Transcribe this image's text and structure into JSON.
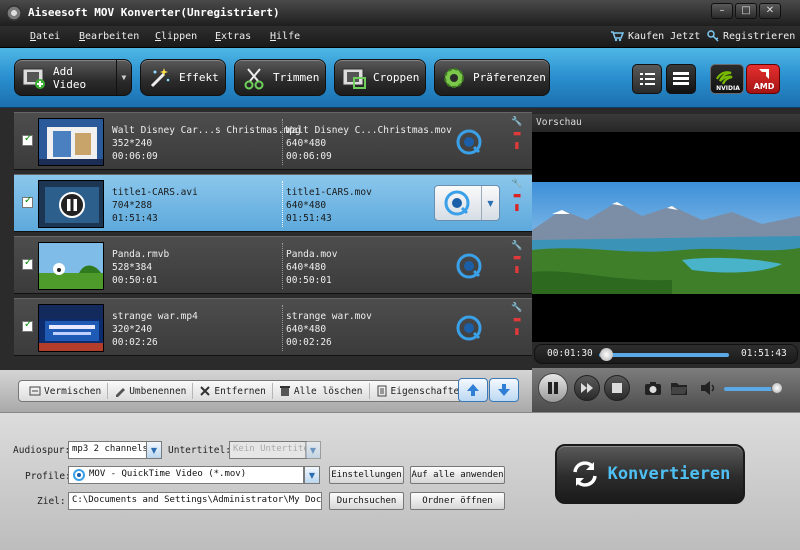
{
  "window": {
    "title": "Aiseesoft MOV Konverter(Unregistriert)",
    "min": "–",
    "max": "□",
    "close": "✕"
  },
  "menu": {
    "items": [
      {
        "label": "Datei",
        "u": "D",
        "rest": "atei"
      },
      {
        "label": "Bearbeiten",
        "u": "B",
        "rest": "earbeiten"
      },
      {
        "label": "Clippen",
        "u": "C",
        "rest": "lippen"
      },
      {
        "label": "Extras",
        "u": "E",
        "rest": "xtras"
      },
      {
        "label": "Hilfe",
        "u": "H",
        "rest": "ilfe"
      }
    ],
    "buy": "Kaufen Jetzt",
    "register": "Registrieren"
  },
  "toolbar": {
    "add_video": "Add Video",
    "effekt": "Effekt",
    "trimmen": "Trimmen",
    "croppen": "Croppen",
    "praeferenzen": "Präferenzen",
    "nvidia": "NVIDIA",
    "amd": "AMD"
  },
  "files": [
    {
      "src_name": "Walt Disney Car...s Christmas.mpg",
      "src_res": "352*240",
      "src_dur": "00:06:09",
      "out_name": "Walt Disney C...Christmas.mov",
      "out_res": "640*480",
      "out_dur": "00:06:09",
      "selected": false
    },
    {
      "src_name": "title1-CARS.avi",
      "src_res": "704*288",
      "src_dur": "01:51:43",
      "out_name": "title1-CARS.mov",
      "out_res": "640*480",
      "out_dur": "01:51:43",
      "selected": true
    },
    {
      "src_name": "Panda.rmvb",
      "src_res": "528*384",
      "src_dur": "00:50:01",
      "out_name": "Panda.mov",
      "out_res": "640*480",
      "out_dur": "00:50:01",
      "selected": false
    },
    {
      "src_name": "strange war.mp4",
      "src_res": "320*240",
      "src_dur": "00:02:26",
      "out_name": "strange war.mov",
      "out_res": "640*480",
      "out_dur": "00:02:26",
      "selected": false
    }
  ],
  "actions": {
    "merge": "Vermischen",
    "rename": "Umbenennen",
    "remove": "Entfernen",
    "clear_all": "Alle löschen",
    "properties": "Eigenschaften"
  },
  "preview": {
    "label": "Vorschau",
    "current_time": "00:01:30",
    "total_time": "01:51:43",
    "progress": 0.02,
    "volume": 0.95
  },
  "settings": {
    "audio_label": "Audiospur:",
    "audio_value": "mp3 2 channels",
    "subtitle_label": "Untertitel:",
    "subtitle_value": "Kein Untertite",
    "profile_label": "Profile:",
    "profile_value": "MOV - QuickTime Video (*.mov)",
    "settings_btn": "Einstellungen",
    "apply_all_btn": "Auf alle anwenden",
    "dest_label": "Ziel:",
    "dest_value": "C:\\Documents and Settings\\Administrator\\My Documen",
    "browse_btn": "Durchsuchen",
    "open_folder_btn": "Ordner öffnen"
  },
  "convert_label": "Konvertieren"
}
